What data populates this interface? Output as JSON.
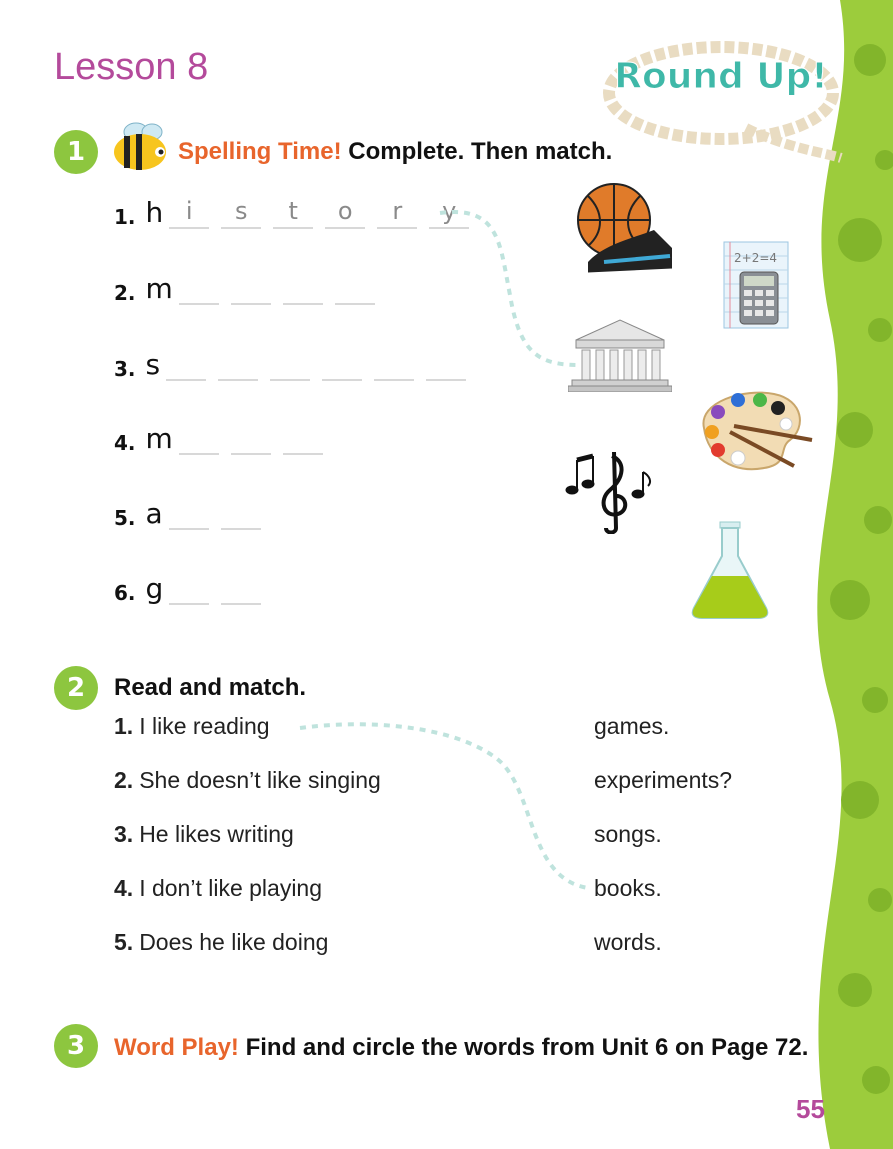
{
  "lesson_title": "Lesson 8",
  "badge": "Round Up!",
  "page_number": "55",
  "section1": {
    "number": "1",
    "highlight": "Spelling Time!",
    "instruction": "Complete. Then match.",
    "items": [
      {
        "num": "1.",
        "first_letter": "h",
        "letters": [
          "i",
          "s",
          "t",
          "o",
          "r",
          "y"
        ]
      },
      {
        "num": "2.",
        "first_letter": "m",
        "letters": [
          "",
          "",
          "",
          ""
        ]
      },
      {
        "num": "3.",
        "first_letter": "s",
        "letters": [
          "",
          "",
          "",
          "",
          "",
          ""
        ]
      },
      {
        "num": "4.",
        "first_letter": "m",
        "letters": [
          "",
          "",
          ""
        ]
      },
      {
        "num": "5.",
        "first_letter": "a",
        "letters": [
          "",
          ""
        ]
      },
      {
        "num": "6.",
        "first_letter": "g",
        "letters": [
          "",
          ""
        ]
      }
    ],
    "pictures": [
      "basketball-and-sneaker-icon",
      "math-calculator-icon",
      "greek-temple-icon",
      "paint-palette-icon",
      "music-notes-icon",
      "science-flask-icon"
    ],
    "picture_text": {
      "calculator_sum": "2+2=4"
    }
  },
  "section2": {
    "number": "2",
    "instruction": "Read and match.",
    "sentences": [
      {
        "num": "1.",
        "text": "I like reading"
      },
      {
        "num": "2.",
        "text": "She doesn’t like singing"
      },
      {
        "num": "3.",
        "text": "He likes writing"
      },
      {
        "num": "4.",
        "text": "I don’t like playing"
      },
      {
        "num": "5.",
        "text": "Does he like doing"
      }
    ],
    "endings": [
      "games.",
      "experiments?",
      "songs.",
      "books.",
      "words."
    ]
  },
  "section3": {
    "number": "3",
    "highlight": "Word Play!",
    "instruction": "Find and circle the words from Unit 6 on Page 72."
  },
  "colors": {
    "title": "#b44a9b",
    "accent_green": "#8dc63f",
    "highlight_orange": "#e8652c",
    "badge_teal": "#3fb8a8"
  }
}
